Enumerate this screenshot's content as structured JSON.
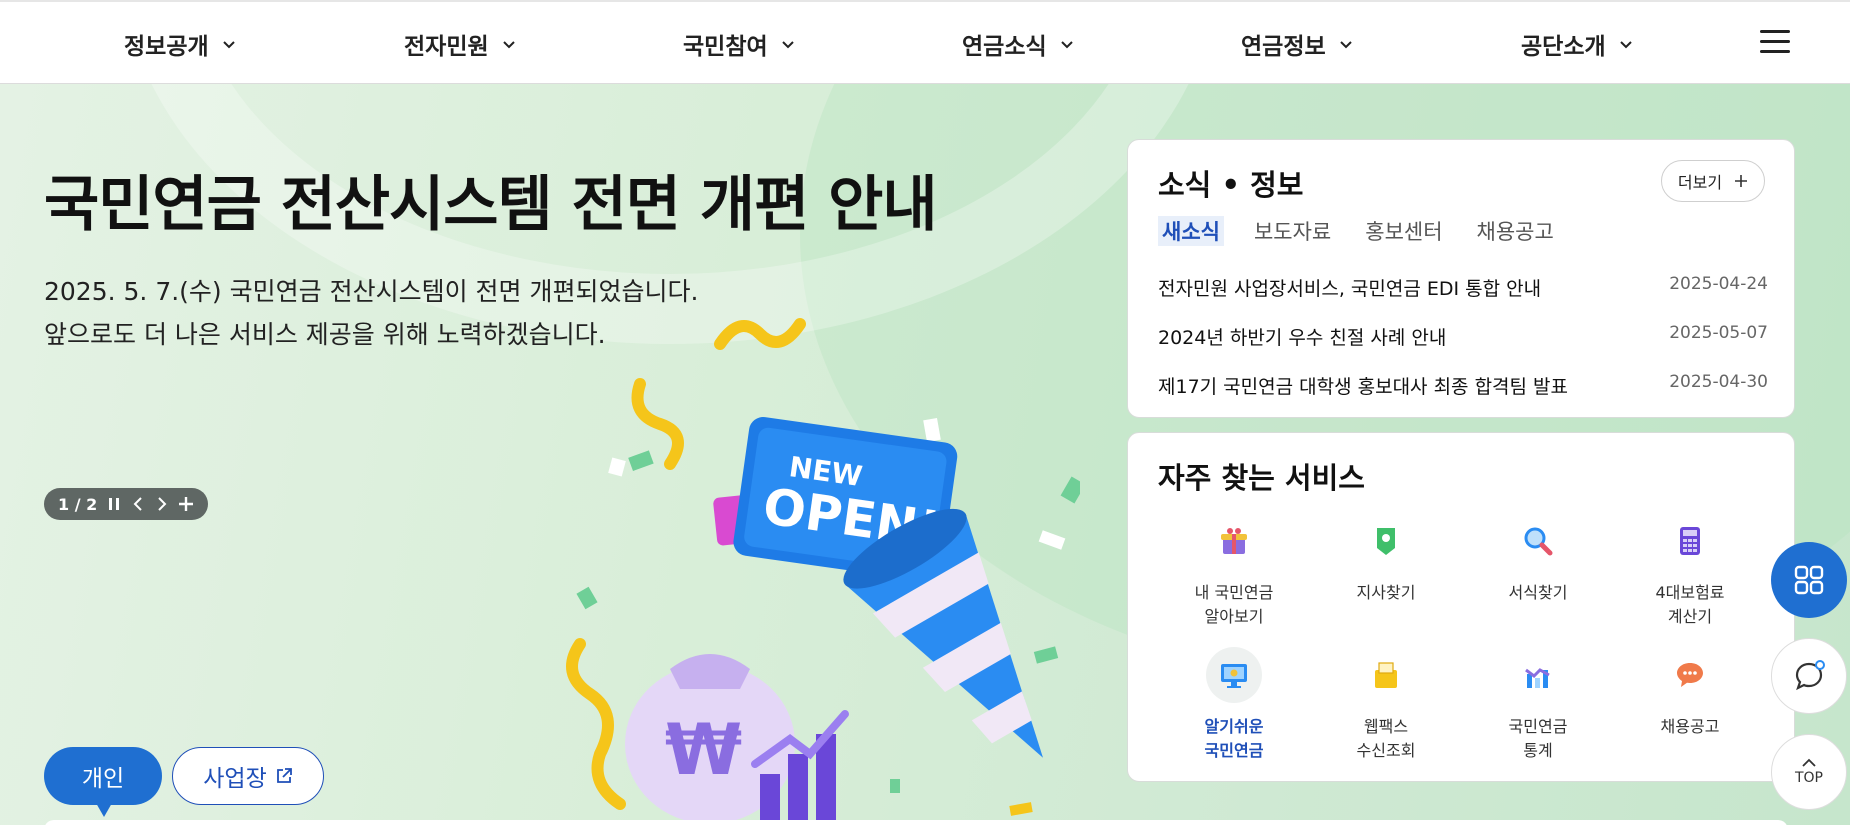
{
  "nav": {
    "items": [
      {
        "label": "정보공개"
      },
      {
        "label": "전자민원"
      },
      {
        "label": "국민참여"
      },
      {
        "label": "연금소식"
      },
      {
        "label": "연금정보"
      },
      {
        "label": "공단소개"
      }
    ]
  },
  "hero": {
    "title": "국민연금 전산시스템 전면 개편 안내",
    "desc_line1": "2025. 5. 7.(수) 국민연금 전산시스템이 전면 개편되었습니다.",
    "desc_line2": "앞으로도 더 나은 서비스 제공을 위해 노력하겠습니다.",
    "pager": "1 / 2",
    "badge_line1": "NEW",
    "badge_line2": "OPEN!",
    "currency_symbol": "₩"
  },
  "user_tabs": {
    "personal": "개인",
    "business": "사업장"
  },
  "news": {
    "title": "소식 • 정보",
    "more_label": "더보기",
    "tabs": [
      "새소식",
      "보도자료",
      "홍보센터",
      "채용공고"
    ],
    "active_tab": "새소식",
    "items": [
      {
        "title": "전자민원 사업장서비스, 국민연금 EDI 통합 안내",
        "date": "2025-04-24"
      },
      {
        "title": "2024년 하반기 우수 친절 사례 안내",
        "date": "2025-05-07"
      },
      {
        "title": "제17기 국민연금 대학생 홍보대사 최종 합격팀 발표",
        "date": "2025-04-30"
      }
    ]
  },
  "services": {
    "title": "자주 찾는 서비스",
    "items": [
      {
        "label": "내 국민연금\n알아보기",
        "icon": "gift-box-icon"
      },
      {
        "label": "지사찾기",
        "icon": "map-pin-icon"
      },
      {
        "label": "서식찾기",
        "icon": "magnifier-icon"
      },
      {
        "label": "4대보험료\n계산기",
        "icon": "calculator-icon"
      },
      {
        "label": "알기쉬운\n국민연금",
        "icon": "monitor-icon",
        "selected": true
      },
      {
        "label": "웹팩스\n수신조회",
        "icon": "fax-icon"
      },
      {
        "label": "국민연금\n통계",
        "icon": "chart-icon"
      },
      {
        "label": "채용공고",
        "icon": "speech-bubble-icon"
      }
    ]
  },
  "floating": {
    "top_label": "TOP"
  },
  "colors": {
    "primary": "#1f6fd1",
    "accent_text": "#1f4fb8",
    "hero_bg": "#d8eed8"
  }
}
